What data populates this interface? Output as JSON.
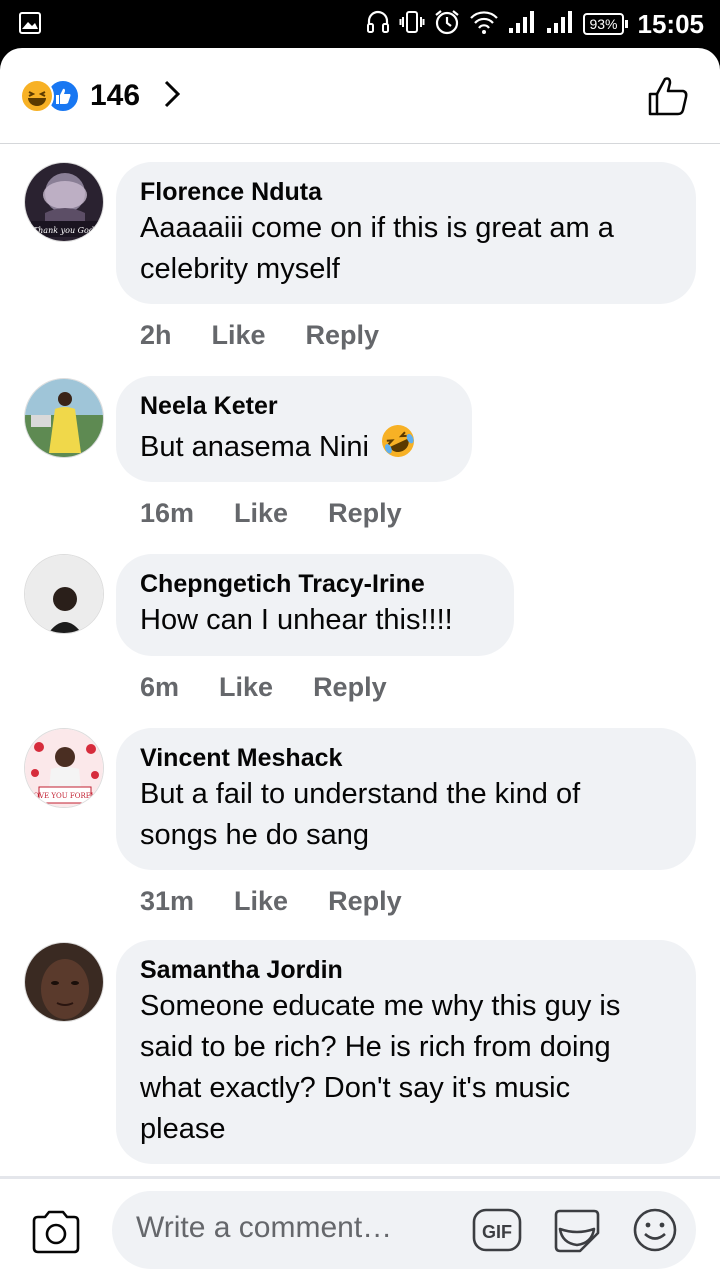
{
  "status_bar": {
    "battery": "93%",
    "time": "15:05"
  },
  "header": {
    "reaction_count": "146"
  },
  "comments": [
    {
      "name": "Florence Nduta",
      "lines": [
        "Aaaaaiii come on if this is great am a",
        "celebrity myself"
      ],
      "time": "2h",
      "like": "Like",
      "reply": "Reply",
      "avatar_text": "Thank you God!"
    },
    {
      "name": "Neela Keter",
      "lines": [
        "But anasema Nini"
      ],
      "time": "16m",
      "like": "Like",
      "reply": "Reply"
    },
    {
      "name": "Chepngetich Tracy-Irine",
      "lines": [
        "How can I unhear this!!!!"
      ],
      "time": "6m",
      "like": "Like",
      "reply": "Reply"
    },
    {
      "name": "Vincent Meshack",
      "lines": [
        "But a fail to understand the kind of",
        "songs he do sang"
      ],
      "time": "31m",
      "like": "Like",
      "reply": "Reply",
      "avatar_text": "I LOVE YOU FOREVER"
    },
    {
      "name": "Samantha Jordin",
      "lines": [
        "Someone educate me why this guy is",
        "said to be rich? He is rich from doing",
        "what exactly? Don't say it's music",
        "please"
      ]
    }
  ],
  "composer": {
    "placeholder": "Write a comment…",
    "gif_label": "GIF"
  },
  "colors": {
    "accent": "#1877f2",
    "haha": "#f7b125",
    "bubble": "#f0f2f5",
    "meta": "#65676b"
  }
}
